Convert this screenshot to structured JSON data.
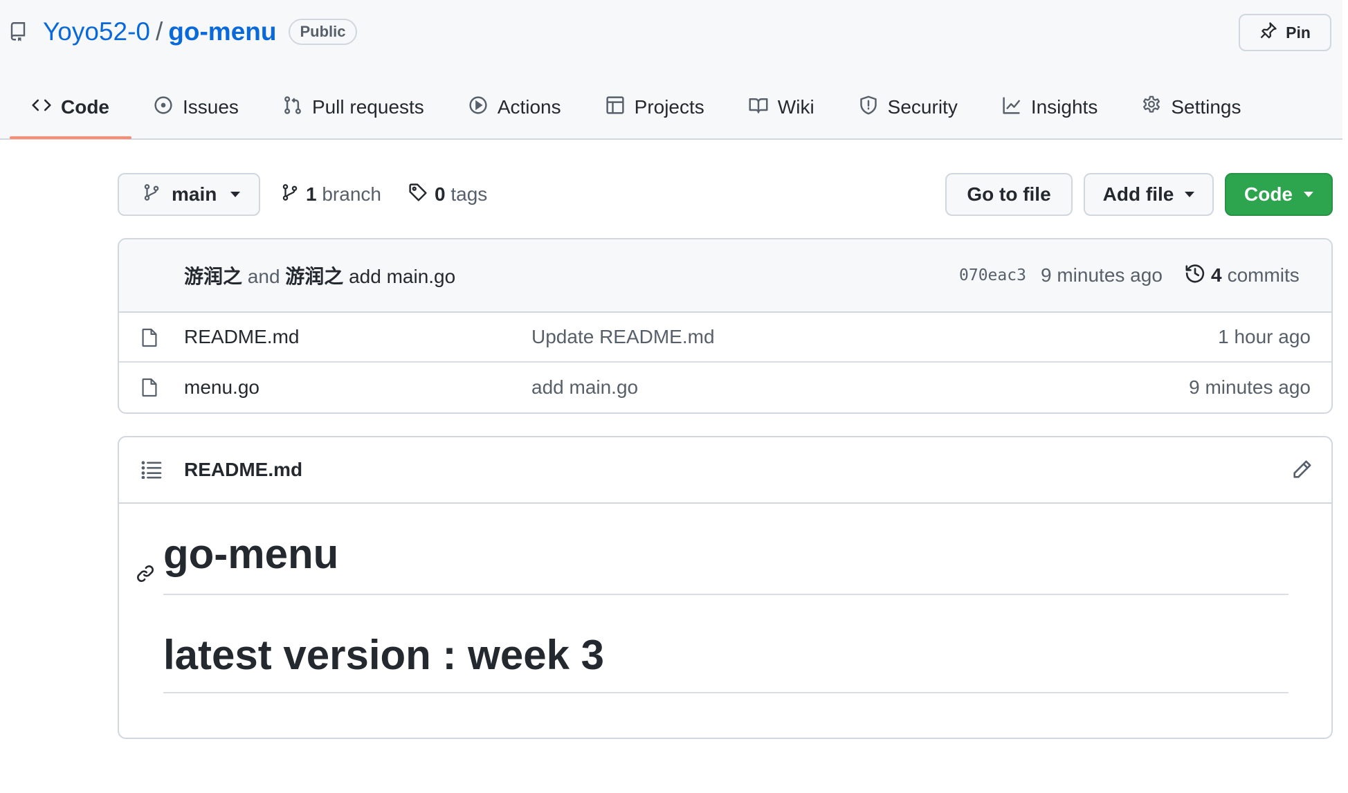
{
  "repo": {
    "owner": "Yoyo52-0",
    "separator": "/",
    "name": "go-menu",
    "visibility": "Public",
    "pin_label": "Pin"
  },
  "tabs": [
    {
      "label": "Code",
      "icon": "code-icon",
      "active": true
    },
    {
      "label": "Issues",
      "icon": "issue-opened-icon"
    },
    {
      "label": "Pull requests",
      "icon": "git-pull-request-icon"
    },
    {
      "label": "Actions",
      "icon": "play-icon"
    },
    {
      "label": "Projects",
      "icon": "table-icon"
    },
    {
      "label": "Wiki",
      "icon": "book-icon"
    },
    {
      "label": "Security",
      "icon": "shield-icon"
    },
    {
      "label": "Insights",
      "icon": "graph-icon"
    },
    {
      "label": "Settings",
      "icon": "gear-icon"
    }
  ],
  "toolbar": {
    "branch_name": "main",
    "branch_count": "1",
    "branch_word": "branch",
    "tag_count": "0",
    "tag_word": "tags",
    "go_to_file": "Go to file",
    "add_file": "Add file",
    "code_button": "Code"
  },
  "latest_commit": {
    "author": "游润之",
    "and": "and",
    "coauthor": "游润之",
    "message": "add main.go",
    "sha": "070eac3",
    "time": "9 minutes ago",
    "commit_count": "4",
    "commit_word": "commits"
  },
  "files": [
    {
      "name": "README.md",
      "message": "Update README.md",
      "age": "1 hour ago"
    },
    {
      "name": "menu.go",
      "message": "add main.go",
      "age": "9 minutes ago"
    }
  ],
  "readme": {
    "filename": "README.md",
    "h1": "go-menu",
    "h2": "latest version : week 3"
  },
  "colors": {
    "link": "#0969da",
    "primary_button": "#2da44e",
    "active_tab_underline": "#fd8c73",
    "header_bg": "#f6f8fa",
    "border": "#d0d7de"
  }
}
